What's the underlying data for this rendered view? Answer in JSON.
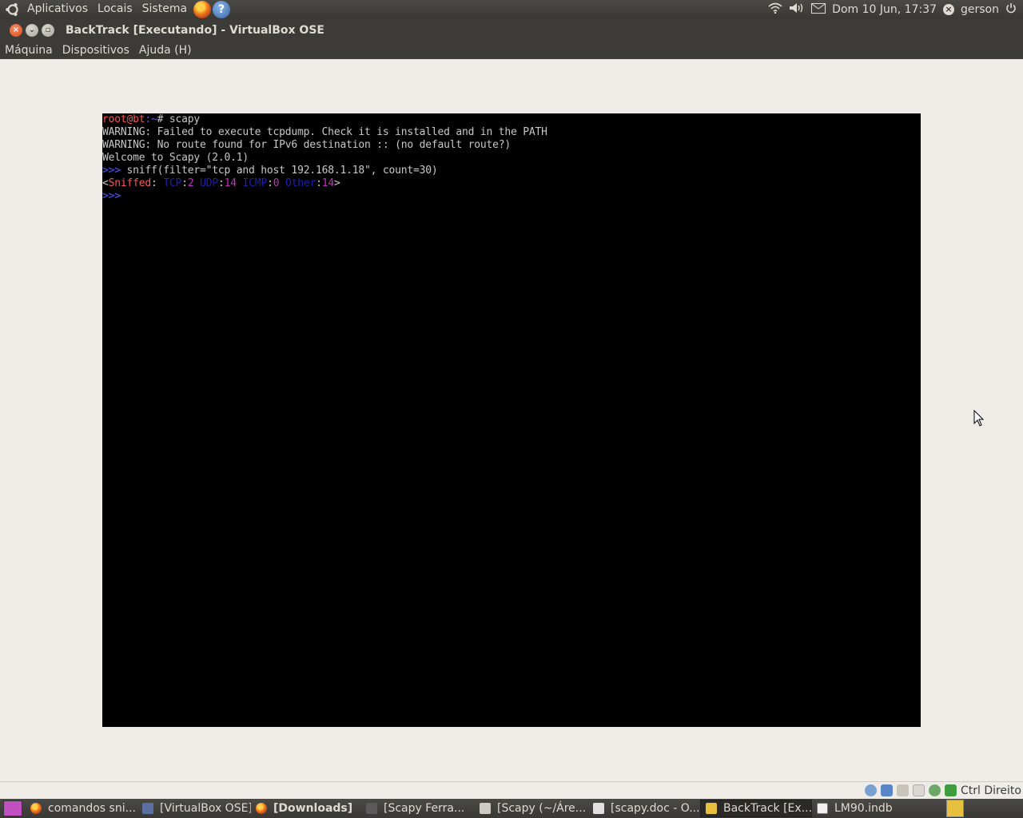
{
  "top_panel": {
    "menus": [
      "Aplicativos",
      "Locais",
      "Sistema"
    ],
    "launchers": [
      "firefox-icon",
      "help-icon"
    ],
    "help_glyph": "?",
    "clock": "Dom 10 Jun, 17:37",
    "user": "gerson"
  },
  "window": {
    "title": "BackTrack [Executando] - VirtualBox OSE",
    "menus": [
      "Máquina",
      "Dispositivos",
      "Ajuda (H)"
    ]
  },
  "console": {
    "prompt_user": "root@bt",
    "prompt_rest": ":~",
    "prompt_hash": "# scapy",
    "warning1": "WARNING: Failed to execute tcpdump. Check it is installed and in the PATH",
    "warning2": "WARNING: No route found for IPv6 destination :: (no default route?)",
    "welcome": "Welcome to Scapy (2.0.1)",
    "py_prompt": ">>>",
    "command": " sniff(filter=\"tcp and host 192.168.1.18\", count=30)",
    "result": {
      "open": "<",
      "label": "Sniffed",
      "colon": ": ",
      "tcp_label": "TCP",
      "tcp_val": "2",
      "udp_label": "UDP",
      "udp_val": "14",
      "icmp_label": "ICMP",
      "icmp_val": "0",
      "other_label": "Other",
      "other_val": "14",
      "close": ">"
    }
  },
  "statusbar": {
    "host_key": "Ctrl Direito"
  },
  "taskbar": {
    "tasks": [
      {
        "label": "comandos sni...",
        "icon": "firefox-icon"
      },
      {
        "label": "[VirtualBox OSE]",
        "icon": "virtualbox-icon"
      },
      {
        "label": "[Downloads]",
        "icon": "downloads-icon"
      },
      {
        "label": "[Scapy  Ferra...",
        "icon": "terminal-icon"
      },
      {
        "label": "[Scapy (~/Áre...",
        "icon": "text-editor-icon"
      },
      {
        "label": "[scapy.doc - O...",
        "icon": "document-icon"
      },
      {
        "label": "BackTrack [Ex...",
        "icon": "backtrack-icon"
      },
      {
        "label": "LM90.indb",
        "icon": "indesign-icon"
      }
    ]
  },
  "colors": {
    "console_bg": "#000000",
    "console_text": "#c8c8c8",
    "prompt_red": "#ff5555",
    "python_prompt_blue": "#5555ff",
    "panel_bg": "#3c3b37"
  }
}
